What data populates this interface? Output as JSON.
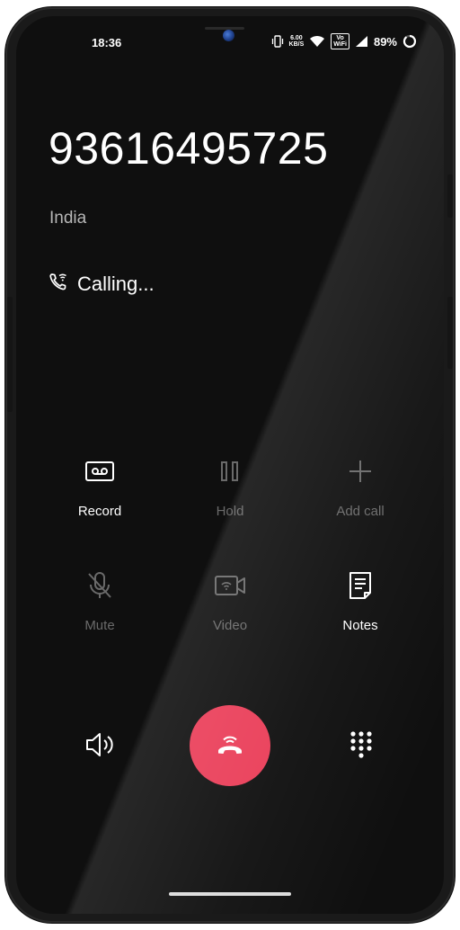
{
  "status_bar": {
    "time": "18:36",
    "net_speed_value": "6.00",
    "net_speed_unit": "KB/S",
    "volte_top": "Vo",
    "volte_bottom": "WiFi",
    "battery_percent": "89%"
  },
  "call": {
    "number": "93616495725",
    "location": "India",
    "status": "Calling..."
  },
  "controls": [
    {
      "label": "Record",
      "icon": "record-icon",
      "enabled": true
    },
    {
      "label": "Hold",
      "icon": "pause-icon",
      "enabled": false
    },
    {
      "label": "Add call",
      "icon": "plus-icon",
      "enabled": false
    },
    {
      "label": "Mute",
      "icon": "mic-off-icon",
      "enabled": false
    },
    {
      "label": "Video",
      "icon": "video-icon",
      "enabled": false
    },
    {
      "label": "Notes",
      "icon": "notes-icon",
      "enabled": true
    }
  ],
  "bottom_actions": {
    "speaker_icon": "speaker-icon",
    "end_call_icon": "end-call-icon",
    "dialpad_icon": "dialpad-icon"
  },
  "colors": {
    "background": "#0f0f0f",
    "end_call": "#ea3d58",
    "active_text": "#ffffff",
    "disabled_text": "#6a6a6a",
    "secondary_text": "#b7b7b7"
  }
}
